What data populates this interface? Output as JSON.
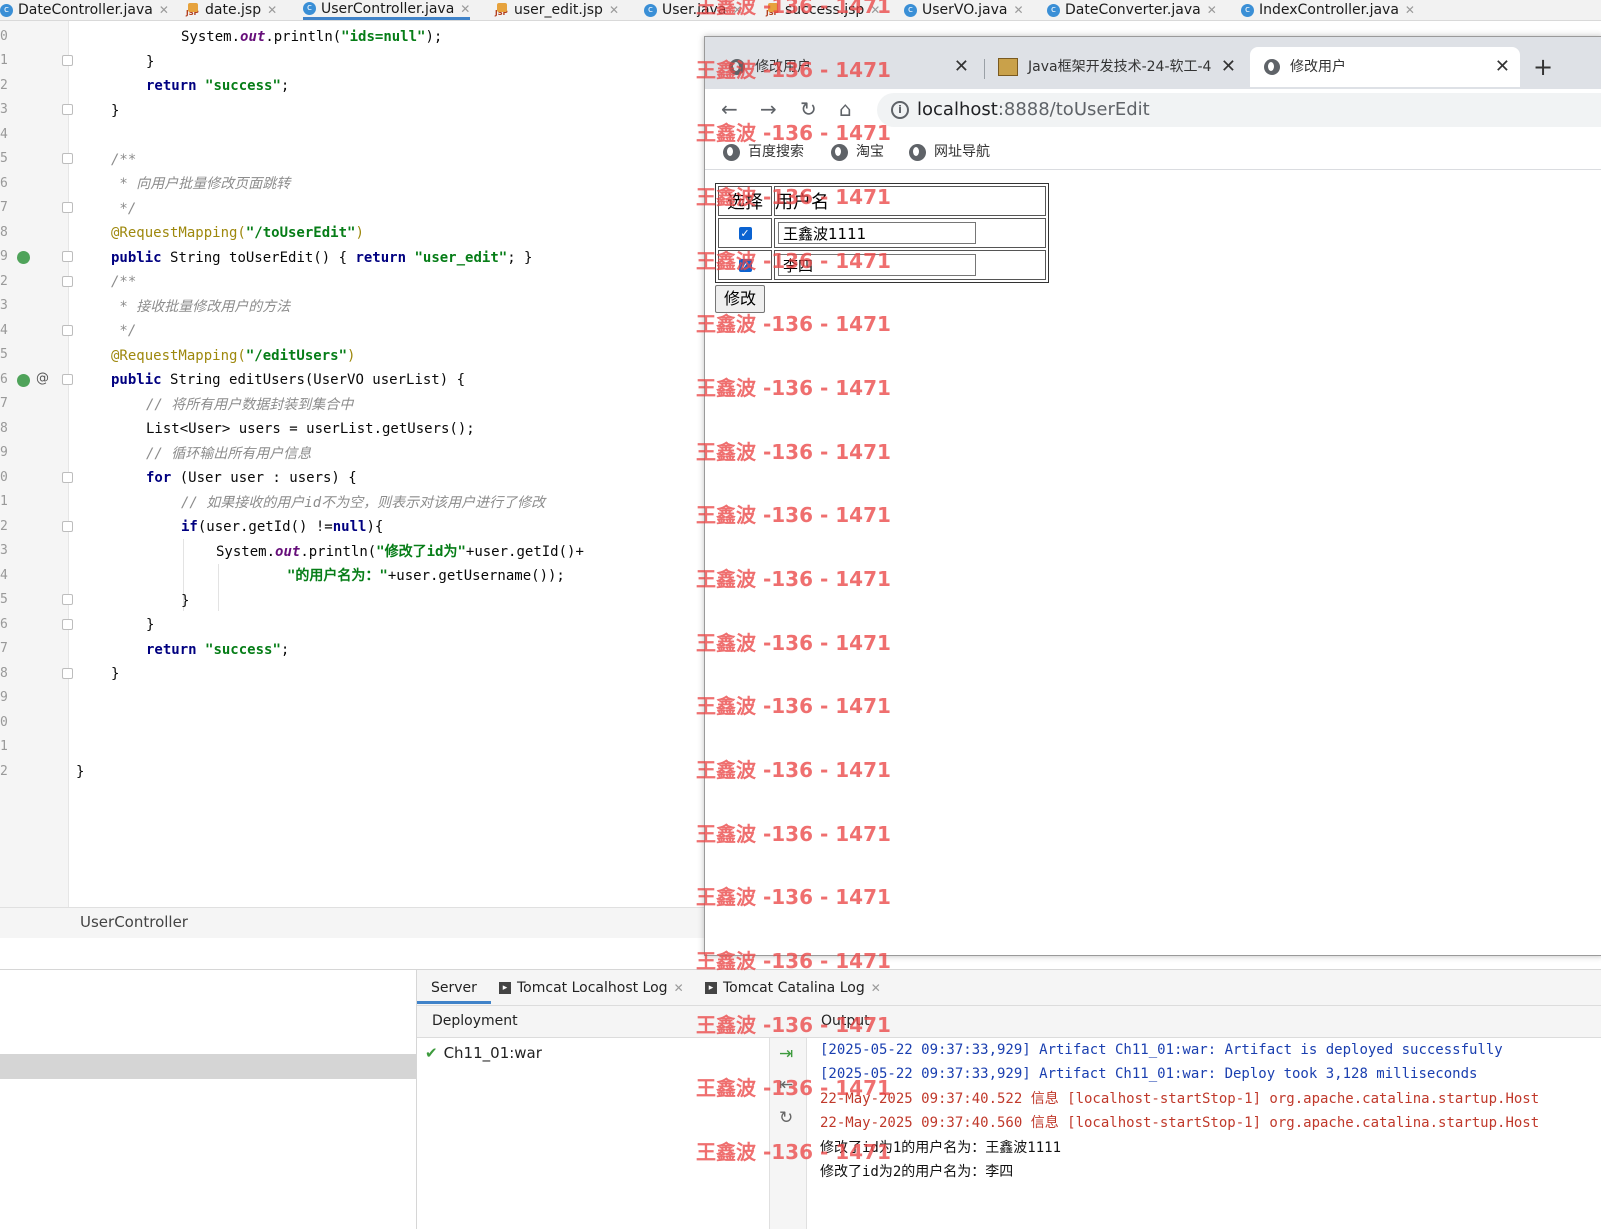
{
  "editor_tabs": [
    {
      "label": "DateController.java",
      "icon": "class-icon"
    },
    {
      "label": "date.jsp",
      "icon": "jsp-icon"
    },
    {
      "label": "UserController.java",
      "icon": "class-icon",
      "active": true
    },
    {
      "label": "user_edit.jsp",
      "icon": "jsp-icon"
    },
    {
      "label": "User.java",
      "icon": "class-icon"
    },
    {
      "label": "success.jsp",
      "icon": "jsp-icon"
    },
    {
      "label": "UserVO.java",
      "icon": "class-icon"
    },
    {
      "label": "DateConverter.java",
      "icon": "class-icon"
    },
    {
      "label": "IndexController.java",
      "icon": "class-icon"
    }
  ],
  "gutter": {
    "line_numbers": [
      "0",
      "1",
      "2",
      "3",
      "4",
      "5",
      "6",
      "7",
      "8",
      "9",
      "2",
      "3",
      "4",
      "5",
      "6",
      "7",
      "8",
      "9",
      "0",
      "1",
      "2",
      "3",
      "4",
      "5",
      "6",
      "7",
      "8",
      "9",
      "0",
      "1",
      "2"
    ]
  },
  "code": {
    "l1": {
      "a": "System.",
      "b": "out",
      "c": ".println(",
      "d": "\"ids=null\"",
      "e": ");"
    },
    "l2": "}",
    "l3": {
      "a": "return ",
      "b": "\"success\"",
      "c": ";"
    },
    "l4": "}",
    "l6": "/**",
    "l7": " * 向用户批量修改页面跳转",
    "l8": " */",
    "l9": {
      "a": "@RequestMapping(",
      "b": "\"/toUserEdit\"",
      "c": ")"
    },
    "l10": {
      "a": "public ",
      "b": "String toUserEdit() { ",
      "c": "return ",
      "d": "\"user_edit\"",
      "e": "; }"
    },
    "l11": "/**",
    "l12": " * 接收批量修改用户的方法",
    "l13": " */",
    "l14": {
      "a": "@RequestMapping(",
      "b": "\"/editUsers\"",
      "c": ")"
    },
    "l15": {
      "a": "public ",
      "b": "String editUsers(UserVO userList) {"
    },
    "l16": "// 将所有用户数据封装到集合中",
    "l17": "List<User> users = userList.getUsers();",
    "l18": "// 循环输出所有用户信息",
    "l19": {
      "a": "for ",
      "b": "(User user : users) {"
    },
    "l20": "// 如果接收的用户id不为空，则表示对该用户进行了修改",
    "l21": {
      "a": "if",
      "b": "(user.getId() !=",
      "c": "null",
      "d": "){"
    },
    "l22": {
      "a": "System.",
      "b": "out",
      "c": ".println(",
      "d": "\"修改了id为\"",
      "e": "+user.getId()+"
    },
    "l23": {
      "a": "\"的用户名为：\"",
      "b": "+user.getUsername());"
    },
    "l24": "}",
    "l25": "}",
    "l26": {
      "a": "return ",
      "b": "\"success\"",
      "c": ";"
    },
    "l27": "}",
    "l28": "}"
  },
  "breadcrumb": "UserController",
  "run_panel": {
    "tabs": [
      "Server",
      "Tomcat Localhost Log",
      "Tomcat Catalina Log"
    ],
    "deployment_header": "Deployment",
    "output_header": "Output",
    "deployment_item": "Ch11_01:war",
    "console_lines": [
      {
        "text": "[2025-05-22 09:37:33,929] Artifact Ch11_01:war: Artifact is deployed successfully",
        "color": "#1a3fb0"
      },
      {
        "text": "[2025-05-22 09:37:33,929] Artifact Ch11_01:war: Deploy took 3,128 milliseconds",
        "color": "#1a3fb0"
      },
      {
        "text": "22-May-2025 09:37:40.522 信息 [localhost-startStop-1] org.apache.catalina.startup.Host",
        "color": "#c0392b"
      },
      {
        "text": "22-May-2025 09:37:40.560 信息 [localhost-startStop-1] org.apache.catalina.startup.Host",
        "color": "#c0392b"
      },
      {
        "text": "修改了id为1的用户名为：王鑫波1111",
        "color": "#111111"
      },
      {
        "text": "修改了id为2的用户名为：李四",
        "color": "#111111"
      }
    ]
  },
  "browser": {
    "tabs": [
      {
        "title": "修改用户",
        "icon": "globe-icon"
      },
      {
        "title": "Java框架开发技术-24-软工-4",
        "icon": "favicon-icon"
      },
      {
        "title": "修改用户",
        "icon": "globe-icon",
        "active": true
      }
    ],
    "url_host": "localhost",
    "url_path": ":8888/toUserEdit",
    "bookmarks": [
      "百度搜索",
      "淘宝",
      "网址导航"
    ],
    "page": {
      "header_select": "选择",
      "header_username": "用户名",
      "rows": [
        {
          "checked": true,
          "username": "王鑫波1111"
        },
        {
          "checked": true,
          "username": "李四"
        }
      ],
      "submit_label": "修改"
    }
  },
  "watermark": "王鑫波 -136 - 1471"
}
